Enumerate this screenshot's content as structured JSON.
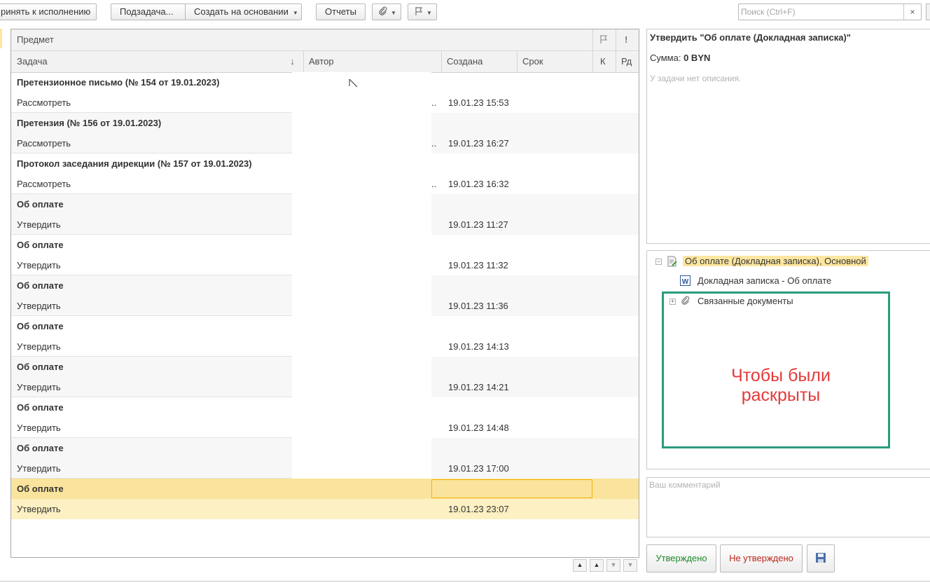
{
  "toolbar": {
    "accept_label": "ринять к исполнению",
    "subtask_label": "Подзадача...",
    "create_based_label": "Создать на основании",
    "reports_label": "Отчеты",
    "attach_icon": "paperclip-icon",
    "flag_icon": "flag-icon",
    "search_placeholder": "Поиск (Ctrl+F)",
    "search_clear": "×"
  },
  "table": {
    "header_subject": "Предмет",
    "columns": {
      "task": "Задача",
      "author": "Автор",
      "created": "Создана",
      "due": "Срок",
      "k": "К",
      "rd": "Рд"
    },
    "sort_indicator": "↓",
    "rows": [
      {
        "subject": "Претензионное письмо (№ 154 от 19.01.2023)",
        "task": "Рассмотреть",
        "author": "..",
        "created": "19.01.23 15:53"
      },
      {
        "subject": "Претензия (№ 156 от 19.01.2023)",
        "task": "Рассмотреть",
        "author": "..",
        "created": "19.01.23 16:27"
      },
      {
        "subject": "Протокол заседания дирекции (№ 157 от 19.01.2023)",
        "task": "Рассмотреть",
        "author": "..",
        "created": "19.01.23 16:32"
      },
      {
        "subject": "Об оплате",
        "task": "Утвердить",
        "author": "",
        "created": "19.01.23 11:27"
      },
      {
        "subject": "Об оплате",
        "task": "Утвердить",
        "author": "",
        "created": "19.01.23 11:32"
      },
      {
        "subject": "Об оплате",
        "task": "Утвердить",
        "author": "",
        "created": "19.01.23 11:36"
      },
      {
        "subject": "Об оплате",
        "task": "Утвердить",
        "author": "",
        "created": "19.01.23 14:13"
      },
      {
        "subject": "Об оплате",
        "task": "Утвердить",
        "author": "",
        "created": "19.01.23 14:21"
      },
      {
        "subject": "Об оплате",
        "task": "Утвердить",
        "author": "",
        "created": "19.01.23 14:48"
      },
      {
        "subject": "Об оплате",
        "task": "Утвердить",
        "author": "",
        "created": "19.01.23 17:00"
      },
      {
        "subject": "Об оплате",
        "task": "Утвердить",
        "author": "",
        "created": "19.01.23 23:07",
        "selected": true
      }
    ]
  },
  "details": {
    "title": "Утвердить \"Об оплате (Докладная записка)\"",
    "sum_label": "Сумма:",
    "sum_value": "0 BYN",
    "description": "У задачи нет описания."
  },
  "tree": {
    "root_label": "Об оплате (Докладная записка), Основной",
    "doc_label": "Докладная записка - Об оплате",
    "related_label": "Связанные документы"
  },
  "annotation": {
    "line1": "Чтобы были",
    "line2": "раскрыты"
  },
  "comment": {
    "placeholder": "Ваш комментарий"
  },
  "actions": {
    "approve_label": "Утверждено",
    "reject_label": "Не утверждено",
    "save_icon": "floppy-disk-icon"
  },
  "colors": {
    "selected_row": "#fdf0c2",
    "selected_header": "#fae39c",
    "annotation_frame": "#2a9c7e",
    "annotation_text": "#e53a3a",
    "approve_text": "#1f8a2a",
    "reject_text": "#c0261c"
  }
}
